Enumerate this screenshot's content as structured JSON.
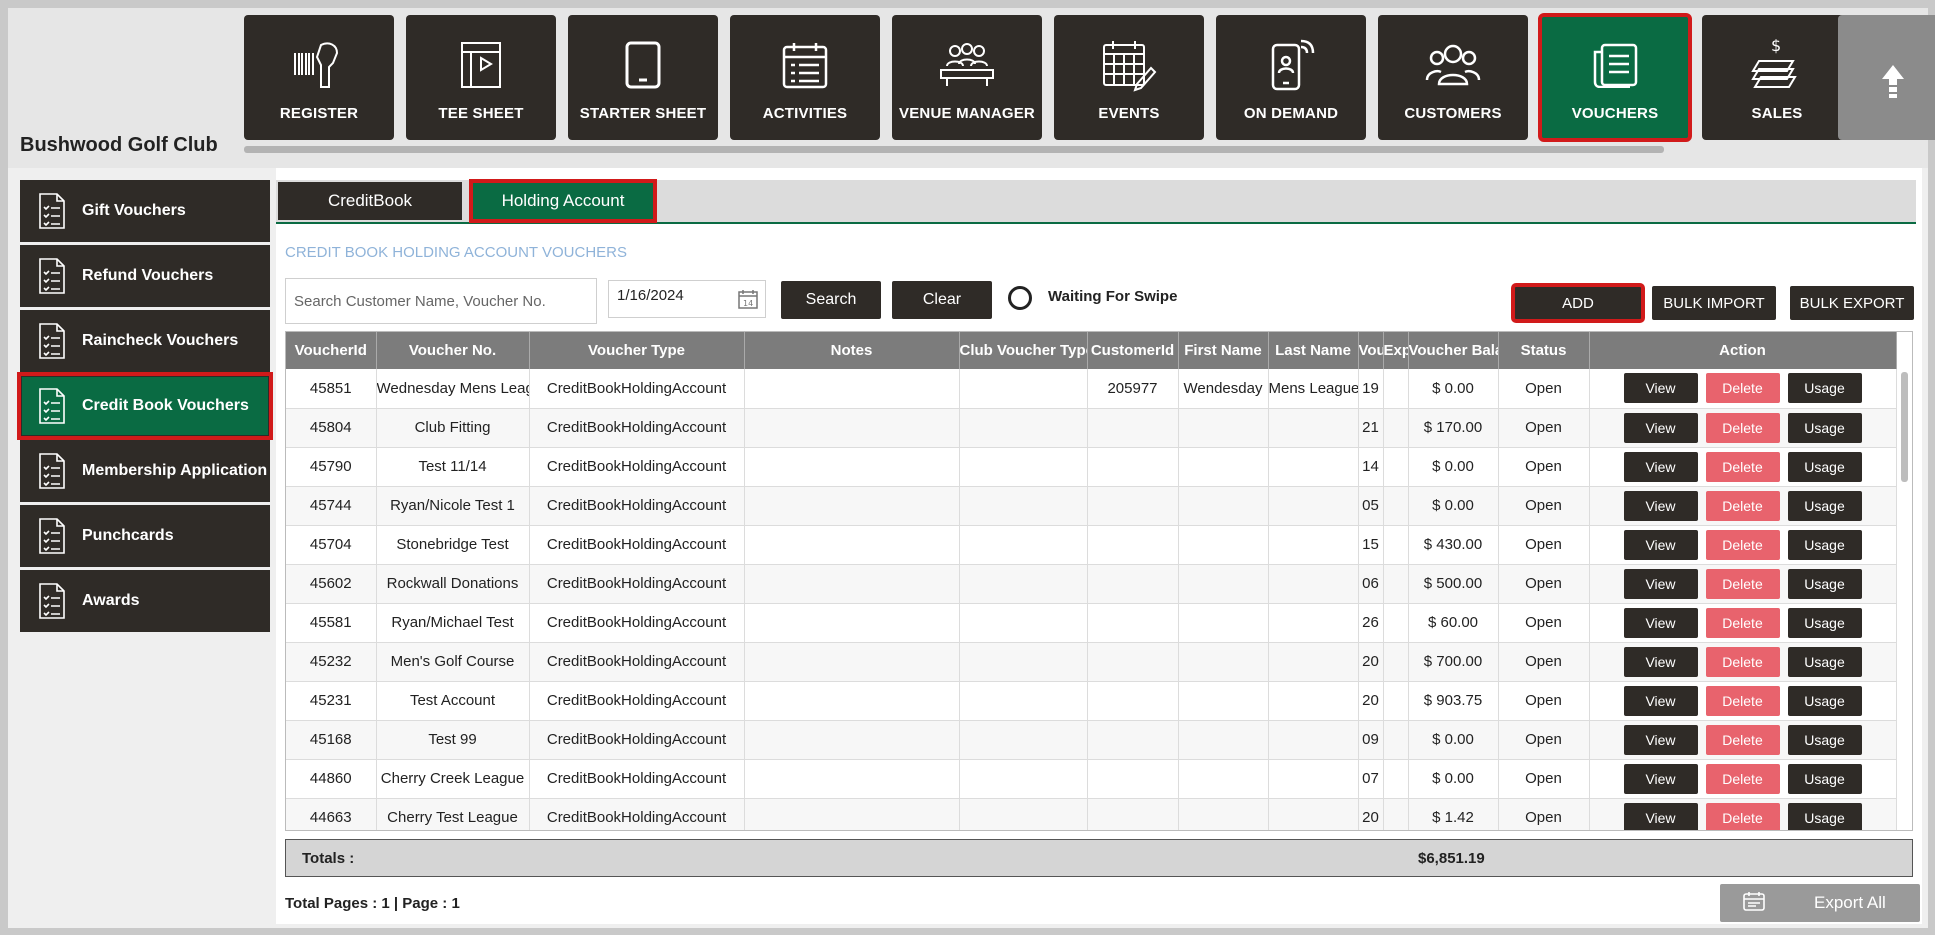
{
  "app": {
    "club_name": "Bushwood Golf Club"
  },
  "nav": [
    {
      "label": "REGISTER",
      "icon": "barcode-scanner-icon"
    },
    {
      "label": "TEE SHEET",
      "icon": "tee-sheet-icon"
    },
    {
      "label": "STARTER SHEET",
      "icon": "tablet-icon"
    },
    {
      "label": "ACTIVITIES",
      "icon": "calendar-list-icon"
    },
    {
      "label": "VENUE MANAGER",
      "icon": "meeting-table-icon"
    },
    {
      "label": "EVENTS",
      "icon": "calendar-pen-icon"
    },
    {
      "label": "ON DEMAND",
      "icon": "phone-user-icon"
    },
    {
      "label": "CUSTOMERS",
      "icon": "users-icon"
    },
    {
      "label": "VOUCHERS",
      "icon": "vouchers-icon",
      "active": true
    },
    {
      "label": "SALES",
      "icon": "cash-icon"
    }
  ],
  "sidebar": {
    "items": [
      {
        "label": "Gift Vouchers"
      },
      {
        "label": "Refund Vouchers"
      },
      {
        "label": "Raincheck Vouchers"
      },
      {
        "label": "Credit Book Vouchers",
        "active": true
      },
      {
        "label": "Membership Application"
      },
      {
        "label": "Punchcards"
      },
      {
        "label": "Awards"
      }
    ]
  },
  "tabs": [
    {
      "label": "CreditBook"
    },
    {
      "label": "Holding Account",
      "active": true
    }
  ],
  "section_title": "CREDIT BOOK HOLDING ACCOUNT VOUCHERS",
  "search": {
    "placeholder": "Search Customer Name, Voucher No.",
    "value": ""
  },
  "date": {
    "value": "1/16/2024"
  },
  "buttons": {
    "search": "Search",
    "clear": "Clear",
    "add": "ADD",
    "bulk_import": "BULK IMPORT",
    "bulk_export": "BULK EXPORT",
    "export_all": "Export All"
  },
  "swipe_label": "Waiting For Swipe",
  "table": {
    "columns": [
      "VoucherId",
      "Voucher No.",
      "Voucher Type",
      "Notes",
      "Club Voucher Type",
      "CustomerId",
      "First Name",
      "Last Name",
      "Vou",
      "Exp",
      "Voucher Balar",
      "Status",
      "Action"
    ],
    "action_labels": {
      "view": "View",
      "delete": "Delete",
      "usage": "Usage"
    },
    "rows": [
      {
        "id": "45851",
        "no": "Wednesday Mens Leag",
        "type": "CreditBookHoldingAccount",
        "notes": "",
        "club_type": "",
        "customer_id": "205977",
        "first": "Wendesday",
        "last": "Mens League",
        "vou": "19",
        "exp": "",
        "balance": "$ 0.00",
        "status": "Open"
      },
      {
        "id": "45804",
        "no": "Club Fitting",
        "type": "CreditBookHoldingAccount",
        "notes": "",
        "club_type": "",
        "customer_id": "",
        "first": "",
        "last": "",
        "vou": "21",
        "exp": "",
        "balance": "$ 170.00",
        "status": "Open"
      },
      {
        "id": "45790",
        "no": "Test 11/14",
        "type": "CreditBookHoldingAccount",
        "notes": "",
        "club_type": "",
        "customer_id": "",
        "first": "",
        "last": "",
        "vou": "14",
        "exp": "",
        "balance": "$ 0.00",
        "status": "Open"
      },
      {
        "id": "45744",
        "no": "Ryan/Nicole Test 1",
        "type": "CreditBookHoldingAccount",
        "notes": "",
        "club_type": "",
        "customer_id": "",
        "first": "",
        "last": "",
        "vou": "05",
        "exp": "",
        "balance": "$ 0.00",
        "status": "Open"
      },
      {
        "id": "45704",
        "no": "Stonebridge Test",
        "type": "CreditBookHoldingAccount",
        "notes": "",
        "club_type": "",
        "customer_id": "",
        "first": "",
        "last": "",
        "vou": "15",
        "exp": "",
        "balance": "$ 430.00",
        "status": "Open"
      },
      {
        "id": "45602",
        "no": "Rockwall Donations",
        "type": "CreditBookHoldingAccount",
        "notes": "",
        "club_type": "",
        "customer_id": "",
        "first": "",
        "last": "",
        "vou": "06",
        "exp": "",
        "balance": "$ 500.00",
        "status": "Open"
      },
      {
        "id": "45581",
        "no": "Ryan/Michael Test",
        "type": "CreditBookHoldingAccount",
        "notes": "",
        "club_type": "",
        "customer_id": "",
        "first": "",
        "last": "",
        "vou": "26",
        "exp": "",
        "balance": "$ 60.00",
        "status": "Open"
      },
      {
        "id": "45232",
        "no": "Men's Golf Course",
        "type": "CreditBookHoldingAccount",
        "notes": "",
        "club_type": "",
        "customer_id": "",
        "first": "",
        "last": "",
        "vou": "20",
        "exp": "",
        "balance": "$ 700.00",
        "status": "Open"
      },
      {
        "id": "45231",
        "no": "Test Account",
        "type": "CreditBookHoldingAccount",
        "notes": "",
        "club_type": "",
        "customer_id": "",
        "first": "",
        "last": "",
        "vou": "20",
        "exp": "",
        "balance": "$ 903.75",
        "status": "Open"
      },
      {
        "id": "45168",
        "no": "Test 99",
        "type": "CreditBookHoldingAccount",
        "notes": "",
        "club_type": "",
        "customer_id": "",
        "first": "",
        "last": "",
        "vou": "09",
        "exp": "",
        "balance": "$ 0.00",
        "status": "Open"
      },
      {
        "id": "44860",
        "no": "Cherry Creek League",
        "type": "CreditBookHoldingAccount",
        "notes": "",
        "club_type": "",
        "customer_id": "",
        "first": "",
        "last": "",
        "vou": "07",
        "exp": "",
        "balance": "$ 0.00",
        "status": "Open"
      },
      {
        "id": "44663",
        "no": "Cherry Test League",
        "type": "CreditBookHoldingAccount",
        "notes": "",
        "club_type": "",
        "customer_id": "",
        "first": "",
        "last": "",
        "vou": "20",
        "exp": "",
        "balance": "$ 1.42",
        "status": "Open"
      }
    ]
  },
  "totals": {
    "label": "Totals :",
    "value": "$6,851.19"
  },
  "pagination": "Total Pages : 1 | Page : 1",
  "colors": {
    "dark": "#2f2b27",
    "green": "#0a6b43",
    "highlight": "#d11a1a",
    "delete": "#e8636d",
    "header_gray": "#7c7c7c"
  }
}
